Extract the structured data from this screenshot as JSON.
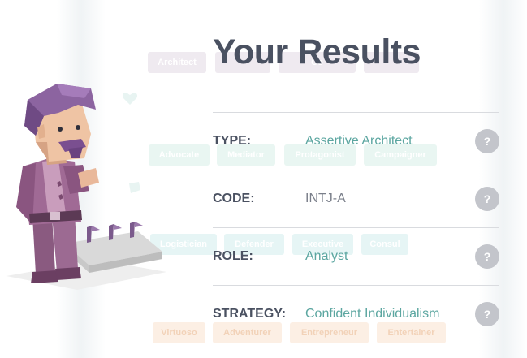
{
  "page": {
    "title": "Your Results"
  },
  "background_chips": {
    "row1": [
      "Architect",
      "",
      "Co",
      ""
    ],
    "row2": [
      "Advocate",
      "Mediator",
      "Protagonist",
      "Campaigner"
    ],
    "row3": [
      "Logistician",
      "Defender",
      "Executive",
      "Consul"
    ],
    "row4": [
      "Virtuoso",
      "Adventurer",
      "Entrepreneur",
      "Entertainer"
    ]
  },
  "results": [
    {
      "label": "TYPE:",
      "value": "Assertive Architect",
      "value_color": "#5ba6a0",
      "help": "?"
    },
    {
      "label": "CODE:",
      "value": "INTJ-A",
      "value_color": "#7a7f8a",
      "help": "?"
    },
    {
      "label": "ROLE:",
      "value": "Analyst",
      "value_color": "#5ba6a0",
      "help": "?"
    },
    {
      "label": "STRATEGY:",
      "value": "Confident Individualism",
      "value_color": "#5ba6a0",
      "help": "?"
    }
  ],
  "icons": {
    "character": "architect-character-illustration",
    "help": "question-mark-icon"
  }
}
